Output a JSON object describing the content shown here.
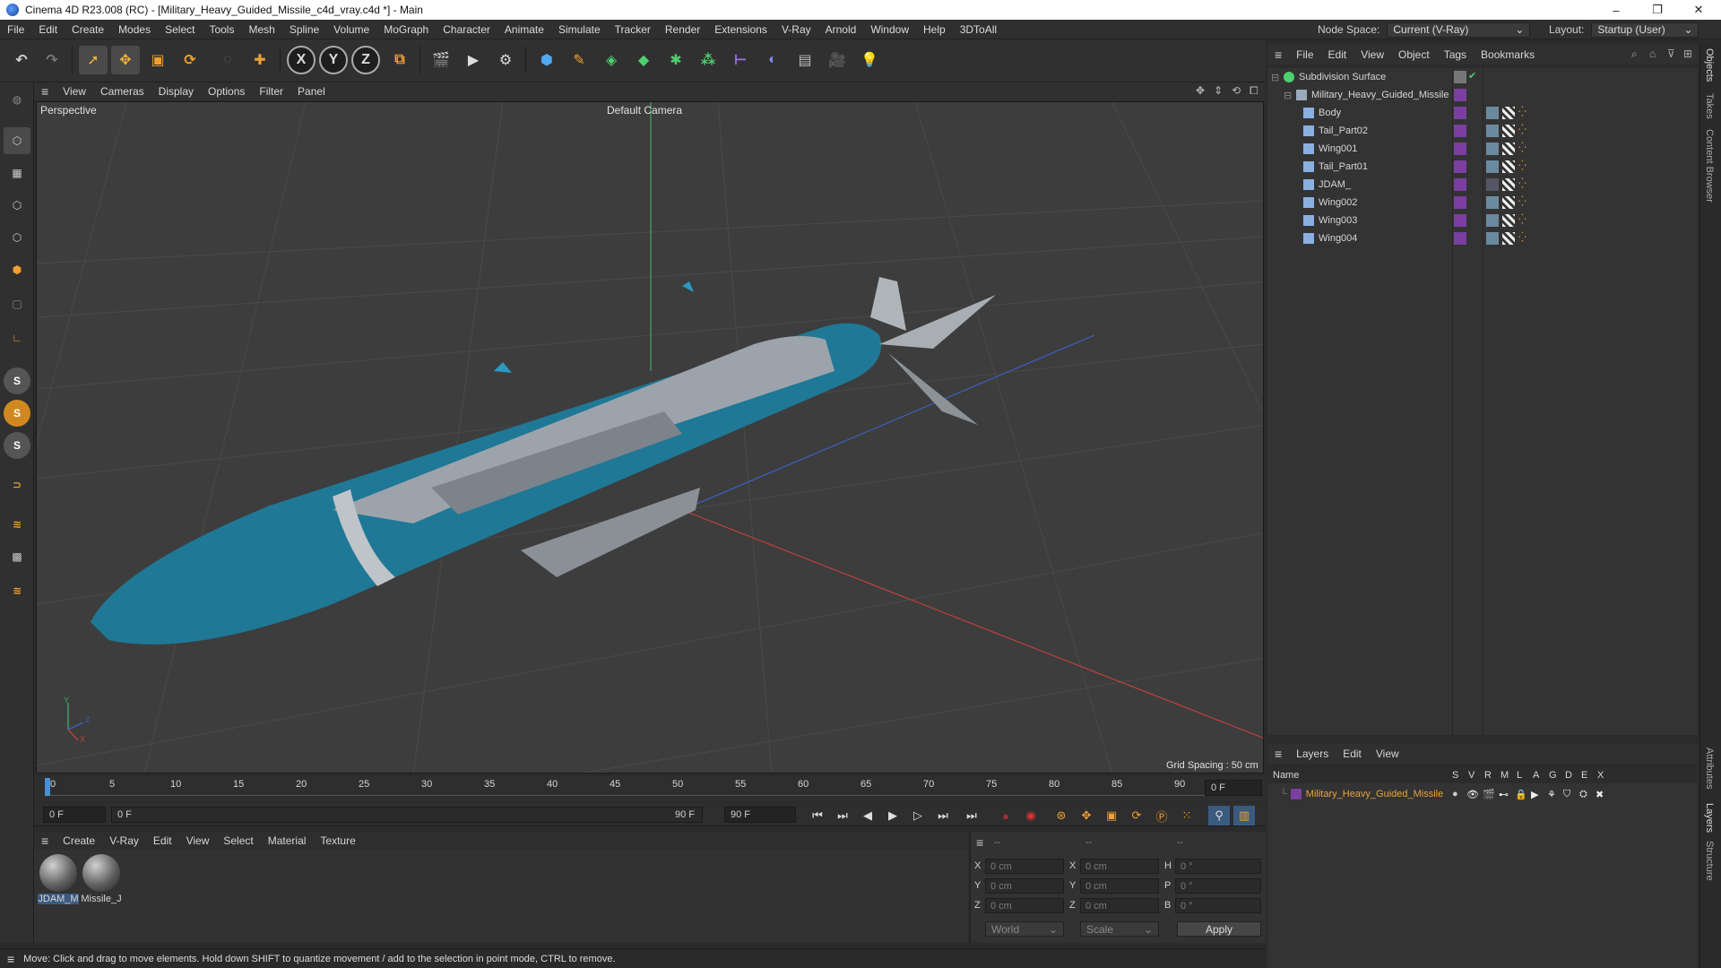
{
  "window": {
    "title": "Cinema 4D R23.008 (RC) - [Military_Heavy_Guided_Missile_c4d_vray.c4d *] - Main",
    "minimize": "–",
    "maximize": "❐",
    "close": "✕"
  },
  "menubar": {
    "items": [
      "File",
      "Edit",
      "Create",
      "Modes",
      "Select",
      "Tools",
      "Mesh",
      "Spline",
      "Volume",
      "MoGraph",
      "Character",
      "Animate",
      "Simulate",
      "Tracker",
      "Render",
      "Extensions",
      "V-Ray",
      "Arnold",
      "Window",
      "Help",
      "3DToAll"
    ],
    "node_space_label": "Node Space:",
    "node_space_value": "Current (V-Ray)",
    "layout_label": "Layout:",
    "layout_value": "Startup (User)"
  },
  "toolbar": {
    "axis_x": "X",
    "axis_y": "Y",
    "axis_z": "Z"
  },
  "viewport": {
    "menu": [
      "View",
      "Cameras",
      "Display",
      "Options",
      "Filter",
      "Panel"
    ],
    "view_name": "Perspective",
    "camera": "Default Camera",
    "grid_spacing": "Grid Spacing : 50 cm",
    "axis_y": "Y",
    "axis_z": "Z",
    "axis_x": "X"
  },
  "timeline": {
    "ticks": [
      "0",
      "5",
      "10",
      "15",
      "20",
      "25",
      "30",
      "35",
      "40",
      "45",
      "50",
      "55",
      "60",
      "65",
      "70",
      "75",
      "80",
      "85",
      "90"
    ],
    "current_frame": "0 F",
    "start_frame": "0 F",
    "range_start": "0 F",
    "range_end": "90 F",
    "end_frame": "90 F"
  },
  "materials": {
    "menu": [
      "Create",
      "V-Ray",
      "Edit",
      "View",
      "Select",
      "Material",
      "Texture"
    ],
    "items": [
      {
        "name": "JDAM_M"
      },
      {
        "name": "Missile_J"
      }
    ]
  },
  "coordinates": {
    "col_headers": [
      "--",
      "--",
      "--"
    ],
    "rows": [
      {
        "l1": "X",
        "v1": "0 cm",
        "l2": "X",
        "v2": "0 cm",
        "l3": "H",
        "v3": "0 °"
      },
      {
        "l1": "Y",
        "v1": "0 cm",
        "l2": "Y",
        "v2": "0 cm",
        "l3": "P",
        "v3": "0 °"
      },
      {
        "l1": "Z",
        "v1": "0 cm",
        "l2": "Z",
        "v2": "0 cm",
        "l3": "B",
        "v3": "0 °"
      }
    ],
    "world": "World",
    "scale": "Scale",
    "apply": "Apply"
  },
  "status": {
    "text": "Move: Click and drag to move elements. Hold down SHIFT to quantize movement / add to the selection in point mode, CTRL to remove."
  },
  "objects": {
    "menu": [
      "File",
      "Edit",
      "View",
      "Object",
      "Tags",
      "Bookmarks"
    ],
    "rows": [
      {
        "name": "Subdivision Surface"
      },
      {
        "name": "Military_Heavy_Guided_Missile"
      },
      {
        "name": "Body"
      },
      {
        "name": "Tail_Part02"
      },
      {
        "name": "Wing001"
      },
      {
        "name": "Tail_Part01"
      },
      {
        "name": "JDAM_"
      },
      {
        "name": "Wing002"
      },
      {
        "name": "Wing003"
      },
      {
        "name": "Wing004"
      }
    ]
  },
  "layers": {
    "menu": [
      "Layers",
      "Edit",
      "View"
    ],
    "header_name": "Name",
    "header_cols": [
      "S",
      "V",
      "R",
      "M",
      "L",
      "A",
      "G",
      "D",
      "E",
      "X"
    ],
    "rows": [
      {
        "name": "Military_Heavy_Guided_Missile"
      }
    ]
  },
  "side_tabs": [
    "Objects",
    "Takes",
    "Content Browser",
    "Attributes",
    "Layers",
    "Structure"
  ],
  "colors": {
    "accent_orange": "#e8a33c",
    "missile_blue": "#1e7a9a",
    "layer_text": "#e8a33c",
    "layer_purple": "#7a3fa0"
  }
}
